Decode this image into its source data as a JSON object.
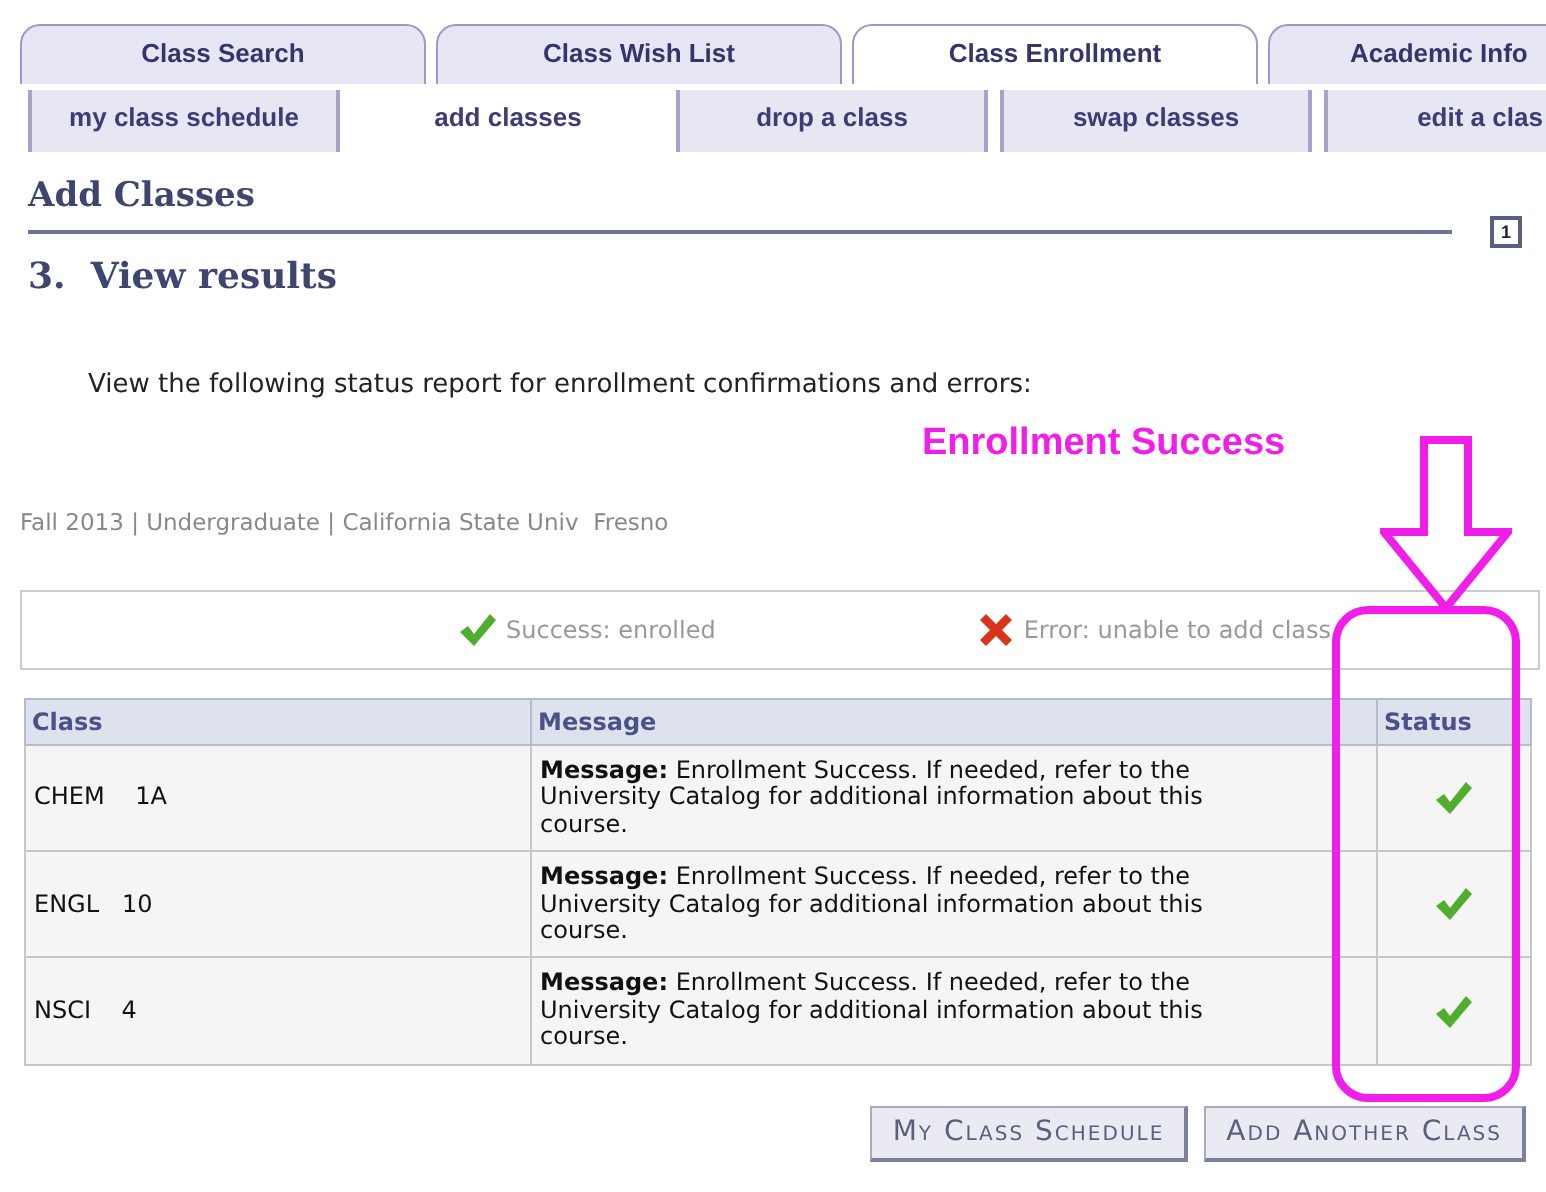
{
  "tabs": [
    {
      "label": "Class Search",
      "selected": false
    },
    {
      "label": "Class Wish List",
      "selected": false
    },
    {
      "label": "Class Enrollment",
      "selected": true
    },
    {
      "label": "Academic Info",
      "selected": false
    }
  ],
  "subtabs": [
    {
      "label": "my class schedule",
      "selected": false
    },
    {
      "label": "add classes",
      "selected": true
    },
    {
      "label": "drop a class",
      "selected": false
    },
    {
      "label": "swap classes",
      "selected": false
    },
    {
      "label": "edit a clas",
      "selected": false
    }
  ],
  "page_title": "Add Classes",
  "step_marker": "1",
  "step_title": "3.  View results",
  "instructions": "View the following status report for enrollment confirmations and errors:",
  "term_info": "Fall 2013 | Undergraduate | California State Univ  Fresno",
  "legend": [
    {
      "kind": "success",
      "label": "Success: enrolled"
    },
    {
      "kind": "error",
      "label": "Error: unable to add class"
    }
  ],
  "table": {
    "columns": [
      "Class",
      "Message",
      "Status"
    ],
    "rows": [
      {
        "class": "CHEM    1A",
        "message": "**Message:** Enrollment Success. If needed, refer to the University Catalog for additional information about this course.",
        "enrolled": true
      },
      {
        "class": "ENGL   10",
        "message": "**Message:** Enrollment Success. If needed, refer to the University Catalog for additional information about this course.",
        "enrolled": true
      },
      {
        "class": "NSCI    4",
        "message": "**Message:** Enrollment Success. If needed, refer to the University Catalog for additional information about this course.",
        "enrolled": true
      }
    ]
  },
  "buttons": [
    "My Class Schedule",
    "Add Another Class"
  ],
  "annotation": {
    "label": "Enrollment Success"
  }
}
